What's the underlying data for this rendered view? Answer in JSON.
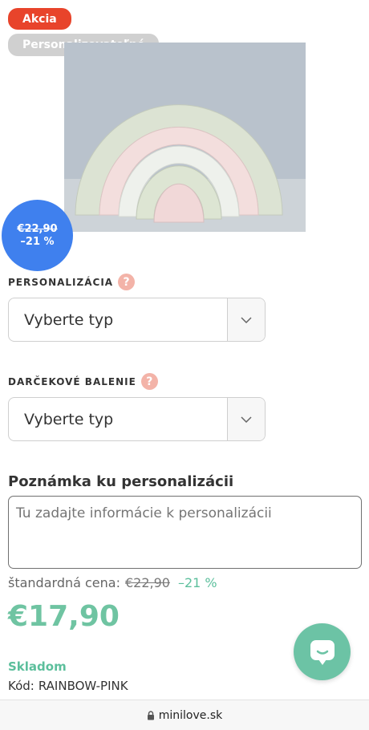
{
  "badges": {
    "sale": "Akcia",
    "customizable": "Personalizovateľné"
  },
  "discount_circle": {
    "old_price": "€22,90",
    "percent": "–21 %",
    "color": "#3f80ee"
  },
  "personalization": {
    "label": "PERSONALIZÁCIA",
    "help": "?",
    "select_value": "Vyberte typ"
  },
  "gift_wrap": {
    "label": "DARČEKOVÉ BALENIE",
    "help": "?",
    "select_value": "Vyberte typ"
  },
  "note": {
    "heading": "Poznámka ku personalizácii",
    "placeholder": "Tu zadajte informácie k personalizácii"
  },
  "pricing": {
    "standard_label": "štandardná cena:",
    "standard_price": "€22,90",
    "discount": "–21 %",
    "price": "€17,90",
    "accent_color": "#6fc4a2"
  },
  "availability": {
    "stock": "Skladom",
    "code_label": "Kód:",
    "code_value": "RAINBOW-PINK"
  },
  "browser": {
    "url": "minilove.sk"
  },
  "icons": {
    "help": "question-mark-icon",
    "select_arrow": "chevron-down-icon",
    "chat": "chat-bubble-icon",
    "lock": "lock-icon"
  }
}
